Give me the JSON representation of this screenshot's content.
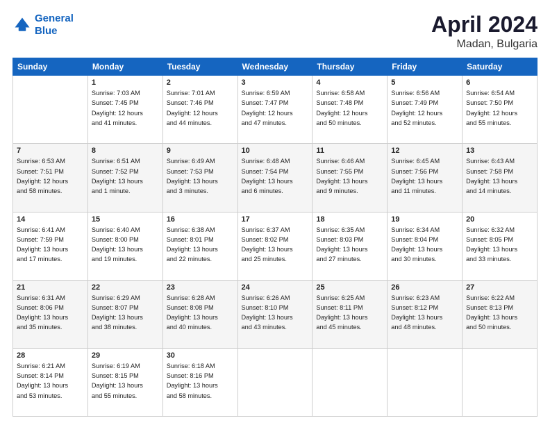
{
  "header": {
    "logo_line1": "General",
    "logo_line2": "Blue",
    "title": "April 2024",
    "subtitle": "Madan, Bulgaria"
  },
  "days_of_week": [
    "Sunday",
    "Monday",
    "Tuesday",
    "Wednesday",
    "Thursday",
    "Friday",
    "Saturday"
  ],
  "weeks": [
    [
      {
        "day": "",
        "info": ""
      },
      {
        "day": "1",
        "info": "Sunrise: 7:03 AM\nSunset: 7:45 PM\nDaylight: 12 hours\nand 41 minutes."
      },
      {
        "day": "2",
        "info": "Sunrise: 7:01 AM\nSunset: 7:46 PM\nDaylight: 12 hours\nand 44 minutes."
      },
      {
        "day": "3",
        "info": "Sunrise: 6:59 AM\nSunset: 7:47 PM\nDaylight: 12 hours\nand 47 minutes."
      },
      {
        "day": "4",
        "info": "Sunrise: 6:58 AM\nSunset: 7:48 PM\nDaylight: 12 hours\nand 50 minutes."
      },
      {
        "day": "5",
        "info": "Sunrise: 6:56 AM\nSunset: 7:49 PM\nDaylight: 12 hours\nand 52 minutes."
      },
      {
        "day": "6",
        "info": "Sunrise: 6:54 AM\nSunset: 7:50 PM\nDaylight: 12 hours\nand 55 minutes."
      }
    ],
    [
      {
        "day": "7",
        "info": "Sunrise: 6:53 AM\nSunset: 7:51 PM\nDaylight: 12 hours\nand 58 minutes."
      },
      {
        "day": "8",
        "info": "Sunrise: 6:51 AM\nSunset: 7:52 PM\nDaylight: 13 hours\nand 1 minute."
      },
      {
        "day": "9",
        "info": "Sunrise: 6:49 AM\nSunset: 7:53 PM\nDaylight: 13 hours\nand 3 minutes."
      },
      {
        "day": "10",
        "info": "Sunrise: 6:48 AM\nSunset: 7:54 PM\nDaylight: 13 hours\nand 6 minutes."
      },
      {
        "day": "11",
        "info": "Sunrise: 6:46 AM\nSunset: 7:55 PM\nDaylight: 13 hours\nand 9 minutes."
      },
      {
        "day": "12",
        "info": "Sunrise: 6:45 AM\nSunset: 7:56 PM\nDaylight: 13 hours\nand 11 minutes."
      },
      {
        "day": "13",
        "info": "Sunrise: 6:43 AM\nSunset: 7:58 PM\nDaylight: 13 hours\nand 14 minutes."
      }
    ],
    [
      {
        "day": "14",
        "info": "Sunrise: 6:41 AM\nSunset: 7:59 PM\nDaylight: 13 hours\nand 17 minutes."
      },
      {
        "day": "15",
        "info": "Sunrise: 6:40 AM\nSunset: 8:00 PM\nDaylight: 13 hours\nand 19 minutes."
      },
      {
        "day": "16",
        "info": "Sunrise: 6:38 AM\nSunset: 8:01 PM\nDaylight: 13 hours\nand 22 minutes."
      },
      {
        "day": "17",
        "info": "Sunrise: 6:37 AM\nSunset: 8:02 PM\nDaylight: 13 hours\nand 25 minutes."
      },
      {
        "day": "18",
        "info": "Sunrise: 6:35 AM\nSunset: 8:03 PM\nDaylight: 13 hours\nand 27 minutes."
      },
      {
        "day": "19",
        "info": "Sunrise: 6:34 AM\nSunset: 8:04 PM\nDaylight: 13 hours\nand 30 minutes."
      },
      {
        "day": "20",
        "info": "Sunrise: 6:32 AM\nSunset: 8:05 PM\nDaylight: 13 hours\nand 33 minutes."
      }
    ],
    [
      {
        "day": "21",
        "info": "Sunrise: 6:31 AM\nSunset: 8:06 PM\nDaylight: 13 hours\nand 35 minutes."
      },
      {
        "day": "22",
        "info": "Sunrise: 6:29 AM\nSunset: 8:07 PM\nDaylight: 13 hours\nand 38 minutes."
      },
      {
        "day": "23",
        "info": "Sunrise: 6:28 AM\nSunset: 8:08 PM\nDaylight: 13 hours\nand 40 minutes."
      },
      {
        "day": "24",
        "info": "Sunrise: 6:26 AM\nSunset: 8:10 PM\nDaylight: 13 hours\nand 43 minutes."
      },
      {
        "day": "25",
        "info": "Sunrise: 6:25 AM\nSunset: 8:11 PM\nDaylight: 13 hours\nand 45 minutes."
      },
      {
        "day": "26",
        "info": "Sunrise: 6:23 AM\nSunset: 8:12 PM\nDaylight: 13 hours\nand 48 minutes."
      },
      {
        "day": "27",
        "info": "Sunrise: 6:22 AM\nSunset: 8:13 PM\nDaylight: 13 hours\nand 50 minutes."
      }
    ],
    [
      {
        "day": "28",
        "info": "Sunrise: 6:21 AM\nSunset: 8:14 PM\nDaylight: 13 hours\nand 53 minutes."
      },
      {
        "day": "29",
        "info": "Sunrise: 6:19 AM\nSunset: 8:15 PM\nDaylight: 13 hours\nand 55 minutes."
      },
      {
        "day": "30",
        "info": "Sunrise: 6:18 AM\nSunset: 8:16 PM\nDaylight: 13 hours\nand 58 minutes."
      },
      {
        "day": "",
        "info": ""
      },
      {
        "day": "",
        "info": ""
      },
      {
        "day": "",
        "info": ""
      },
      {
        "day": "",
        "info": ""
      }
    ]
  ]
}
